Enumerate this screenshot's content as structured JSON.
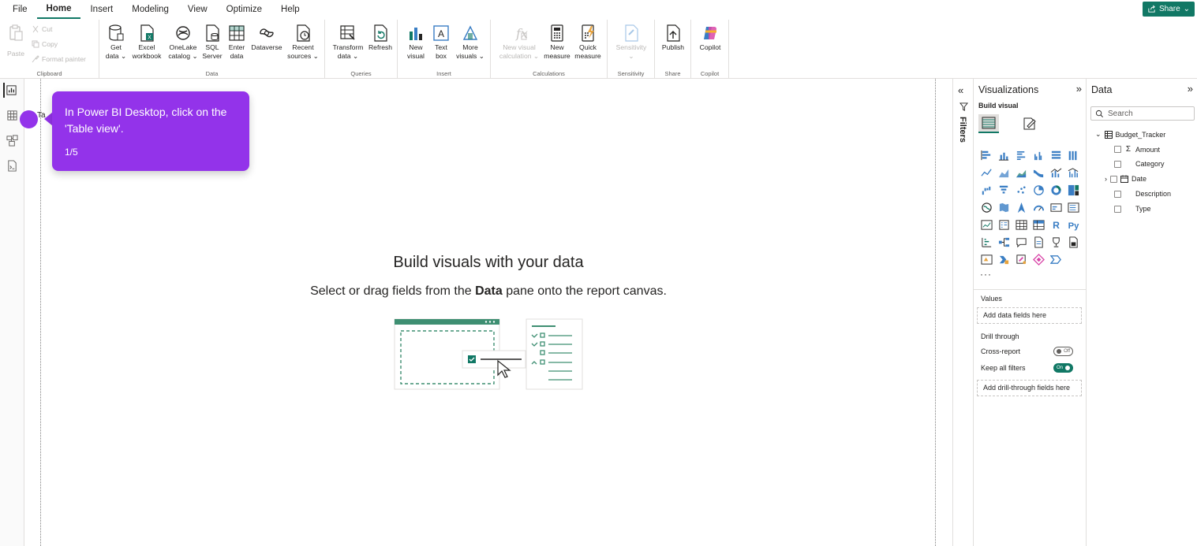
{
  "menu": {
    "items": [
      "File",
      "Home",
      "Insert",
      "Modeling",
      "View",
      "Optimize",
      "Help"
    ],
    "active": "Home",
    "share_label": "Share"
  },
  "ribbon": {
    "clipboard": {
      "paste": "Paste",
      "cut": "Cut",
      "copy": "Copy",
      "format_painter": "Format painter",
      "label": "Clipboard"
    },
    "data": {
      "get_data": [
        "Get",
        "data ⌄"
      ],
      "excel": [
        "Excel",
        "workbook"
      ],
      "onelake": [
        "OneLake",
        "catalog ⌄"
      ],
      "sql": [
        "SQL",
        "Server"
      ],
      "enter_data": [
        "Enter",
        "data"
      ],
      "dataverse": "Dataverse",
      "recent": [
        "Recent",
        "sources ⌄"
      ],
      "label": "Data"
    },
    "queries": {
      "transform": [
        "Transform",
        "data ⌄"
      ],
      "refresh": "Refresh",
      "label": "Queries"
    },
    "insert": {
      "new_visual": [
        "New",
        "visual"
      ],
      "text_box": [
        "Text",
        "box"
      ],
      "more_visuals": [
        "More",
        "visuals ⌄"
      ],
      "label": "Insert"
    },
    "calculations": {
      "new_visual_calc": [
        "New visual",
        "calculation ⌄"
      ],
      "new_measure": [
        "New",
        "measure"
      ],
      "quick_measure": [
        "Quick",
        "measure"
      ],
      "label": "Calculations"
    },
    "sensitivity": {
      "btn": [
        "Sensitivity",
        "⌄"
      ],
      "label": "Sensitivity"
    },
    "share": {
      "publish": "Publish",
      "label": "Share"
    },
    "copilot": {
      "btn": "Copilot",
      "label": "Copilot"
    }
  },
  "canvas": {
    "title": "Build visuals with your data",
    "subtitle_pre": "Select or drag fields from the ",
    "subtitle_bold": "Data",
    "subtitle_post": " pane onto the report canvas.",
    "peek_text": "Ta"
  },
  "tooltip": {
    "text": "In Power BI Desktop, click on the 'Table view'.",
    "step": "1/5",
    "color": "#9333ea"
  },
  "filters": {
    "label": "Filters"
  },
  "visualizations": {
    "title": "Visualizations",
    "build_visual": "Build visual",
    "more": "···",
    "values_label": "Values",
    "values_well": "Add data fields here",
    "drill_through": "Drill through",
    "cross_report": "Cross-report",
    "cross_report_state": "Off",
    "keep_filters": "Keep all filters",
    "keep_filters_state": "On",
    "drill_well": "Add drill-through fields here"
  },
  "data_pane": {
    "title": "Data",
    "search_placeholder": "Search",
    "table": "Budget_Tracker",
    "fields": [
      {
        "name": "Amount",
        "icon": "sigma-icon"
      },
      {
        "name": "Category",
        "icon": ""
      },
      {
        "name": "Date",
        "icon": "calendar-icon"
      },
      {
        "name": "Description",
        "icon": ""
      },
      {
        "name": "Type",
        "icon": ""
      }
    ]
  },
  "colors": {
    "accent": "#117865",
    "tooltip": "#9333ea"
  }
}
